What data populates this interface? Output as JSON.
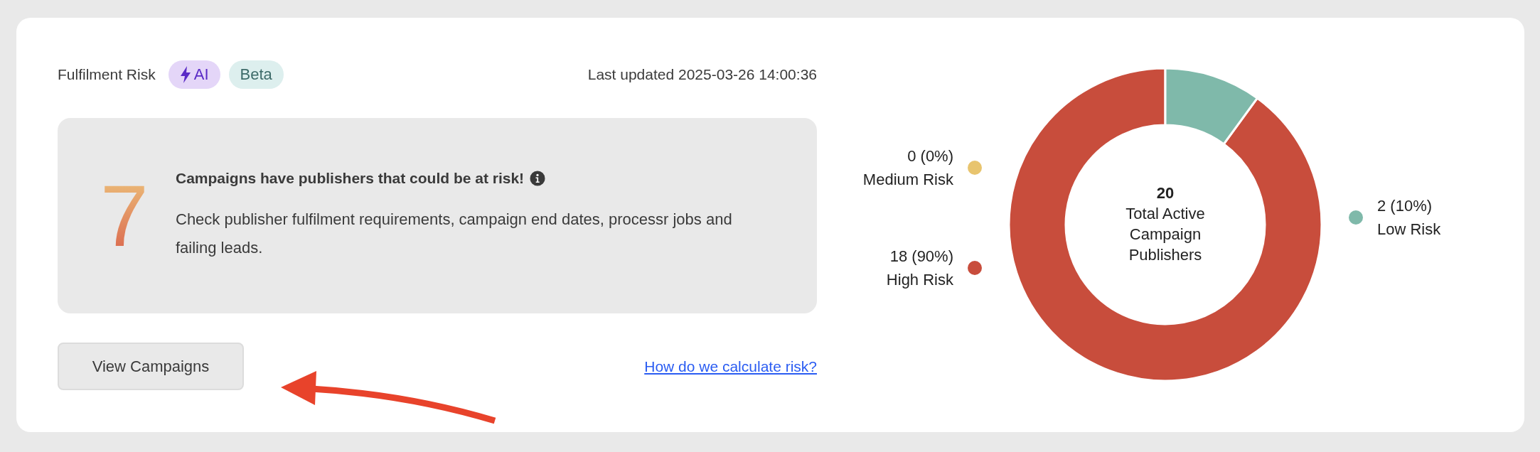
{
  "header": {
    "title": "Fulfilment Risk",
    "badges": [
      {
        "label": "AI",
        "kind": "ai"
      },
      {
        "label": "Beta",
        "kind": "plain"
      }
    ],
    "last_updated": "Last updated 2025-03-26 14:00:36"
  },
  "alert": {
    "count": "7",
    "title": "Campaigns have publishers that could be at risk!",
    "body": "Check publisher fulfilment requirements, campaign end dates, processr jobs and failing leads."
  },
  "actions": {
    "button": "View Campaigns",
    "link": "How do we calculate risk?"
  },
  "chart": {
    "center_value": "20",
    "center_label": "Total Active Campaign Publishers",
    "legend": [
      {
        "count": "0 (0%)",
        "color": "#e8c46e"
      },
      {
        "count": "18 (90%)",
        "color": "#c84d3c"
      },
      {
        "count": "2 (10%)",
        "color": "#7fb9aa"
      }
    ],
    "chart_data": {
      "type": "donut",
      "categories": [
        "Medium Risk",
        "High Risk",
        "Low Risk"
      ],
      "values": [
        0,
        90,
        10
      ]
    }
  }
}
